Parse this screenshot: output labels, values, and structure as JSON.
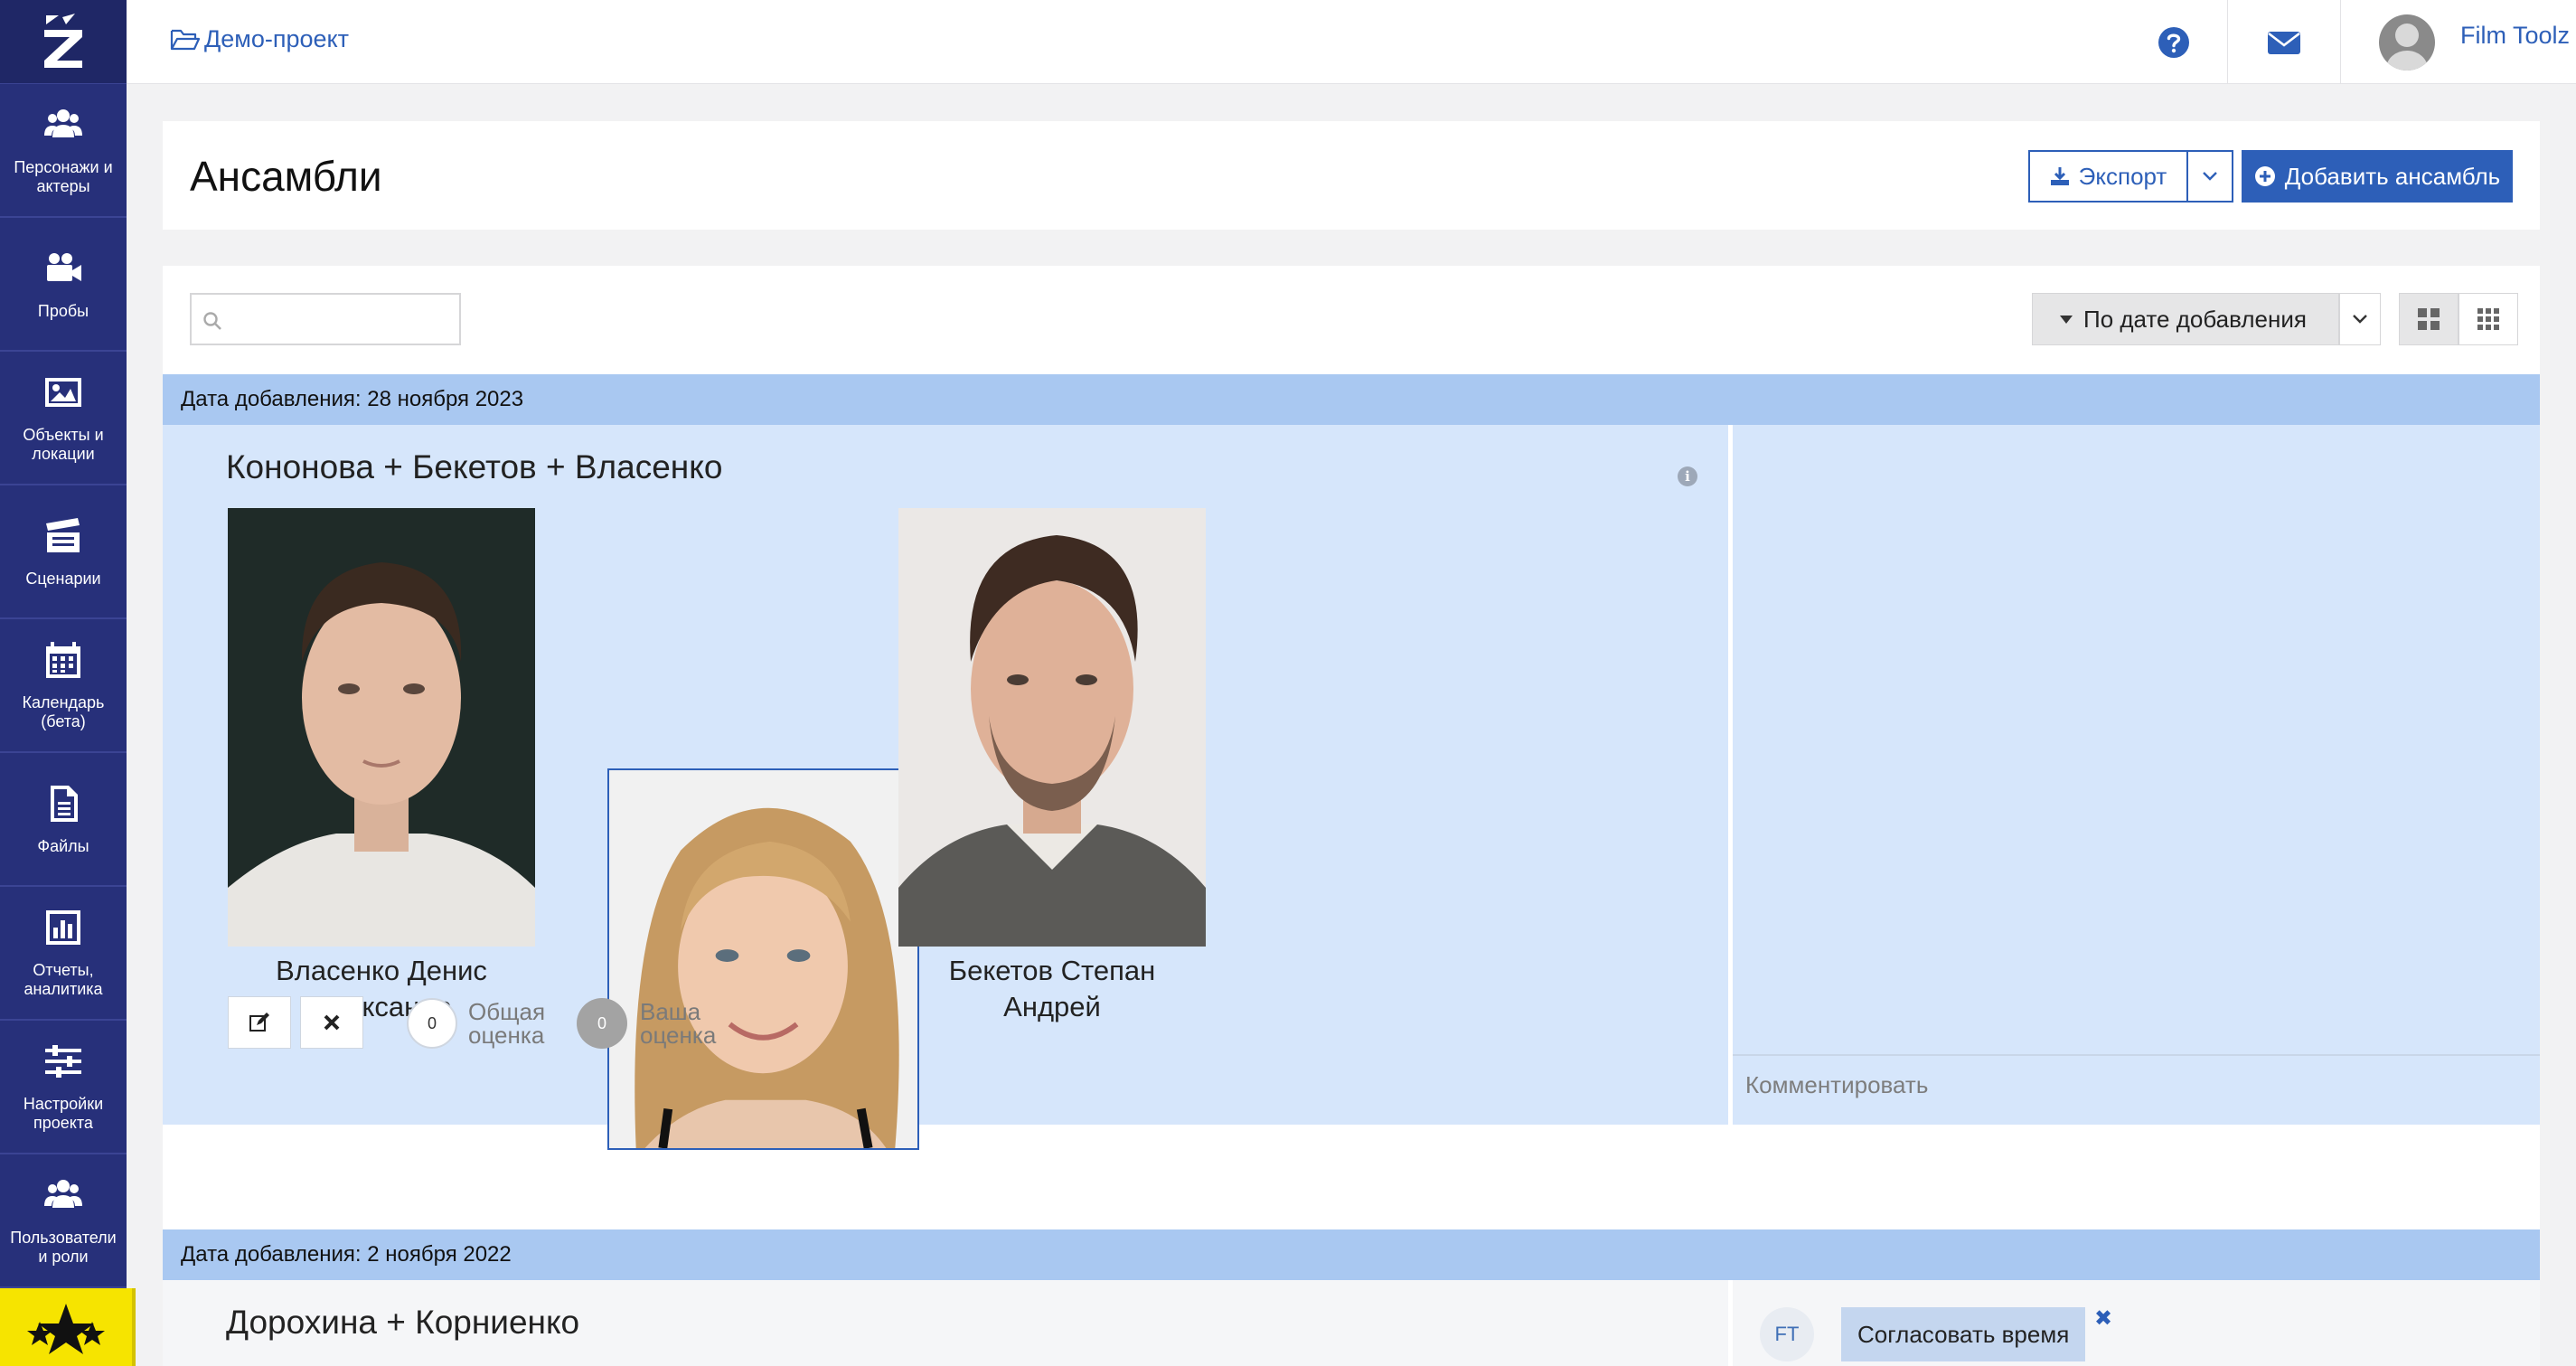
{
  "topbar": {
    "breadcrumb": "Демо-проект",
    "user_name": "Film Toolz"
  },
  "sidebar": {
    "items": [
      {
        "label": "Персонажи и актеры",
        "icon": "users-icon"
      },
      {
        "label": "Пробы",
        "icon": "video-camera-icon"
      },
      {
        "label": "Объекты и локации",
        "icon": "image-icon"
      },
      {
        "label": "Сценарии",
        "icon": "clapperboard-icon"
      },
      {
        "label": "Календарь (бета)",
        "icon": "calendar-icon"
      },
      {
        "label": "Файлы",
        "icon": "file-icon"
      },
      {
        "label": "Отчеты, аналитика",
        "icon": "bar-chart-icon"
      },
      {
        "label": "Настройки проекта",
        "icon": "sliders-icon"
      },
      {
        "label": "Пользователи и роли",
        "icon": "users-icon"
      }
    ]
  },
  "header": {
    "title": "Ансамбли",
    "export_label": "Экспорт",
    "add_label": "Добавить ансамбль"
  },
  "toolbar": {
    "search_placeholder": "",
    "sort_label": "По дате добавления"
  },
  "groups": [
    {
      "date_label": "Дата добавления: 28 ноября 2023",
      "ensemble": {
        "title": "Кононова + Бекетов + Власенко",
        "actors": [
          {
            "first": "Власенко Денис",
            "second": "Александр"
          },
          {
            "first": "",
            "second": ""
          },
          {
            "first": "Бекетов Степан",
            "second": "Андрей"
          }
        ],
        "overall_score": "0",
        "overall_label": "Общая оценка",
        "your_score": "0",
        "your_label": "Ваша оценка",
        "comment_placeholder": "Комментировать"
      }
    },
    {
      "date_label": "Дата добавления: 2 ноября 2022",
      "ensemble": {
        "title": "Дорохина + Корниенко",
        "author_badge": "FT",
        "chip_label": "Согласовать время"
      }
    }
  ],
  "colors": {
    "sidebar": "#27307a",
    "accent": "#2d5fb8",
    "group_bar": "#a9c8f1",
    "ensemble_bg": "#d6e6fb",
    "star_tile": "#f6e400"
  }
}
